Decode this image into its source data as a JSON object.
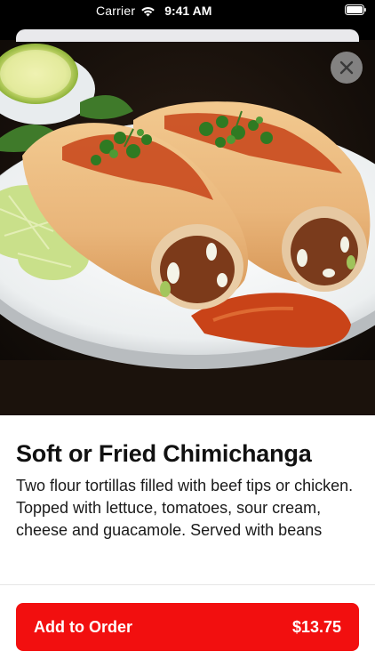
{
  "status_bar": {
    "carrier": "Carrier",
    "time": "9:41 AM",
    "icons": [
      "wifi-icon",
      "battery-icon"
    ]
  },
  "item": {
    "title": "Soft or Fried Chimichanga",
    "description": "Two flour tortillas filled with beef tips or chicken. Topped with lettuce, tomatoes, sour cream, cheese and guacamole. Served with beans",
    "image_icon": "chimichanga-photo"
  },
  "actions": {
    "close_icon": "close-icon",
    "add_label": "Add to Order",
    "price": "$13.75"
  },
  "colors": {
    "accent": "#f20f0f",
    "close_button_bg": "#969696",
    "title_text": "#111111"
  }
}
